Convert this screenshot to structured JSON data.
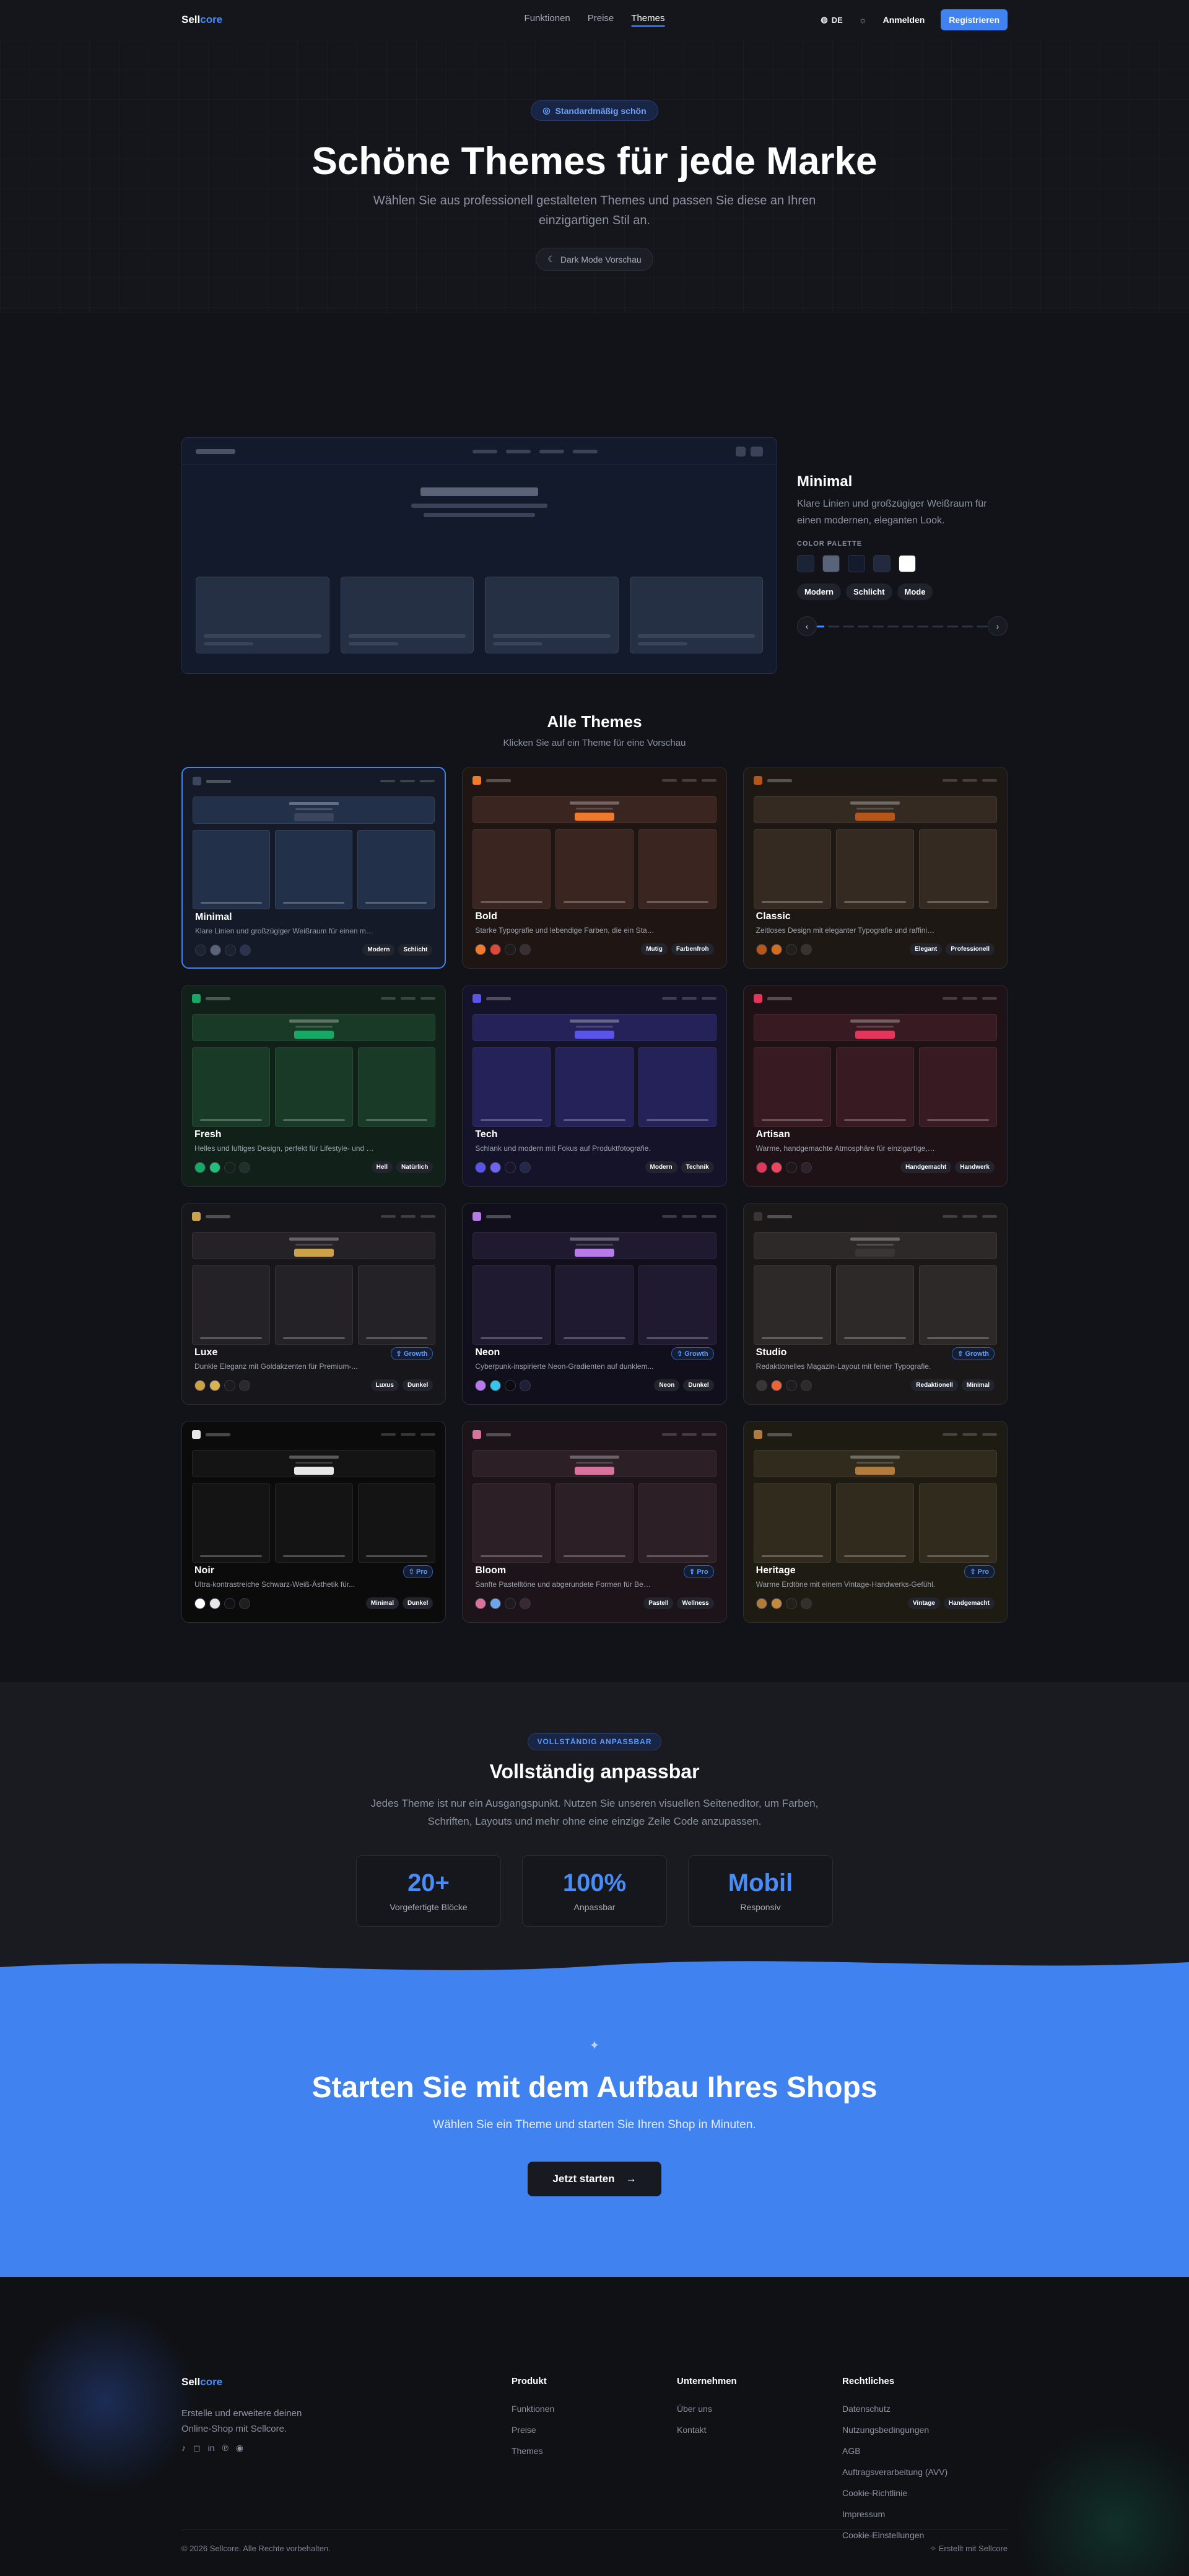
{
  "nav": {
    "logo_a": "Sell",
    "logo_b": "core",
    "links": [
      "Funktionen",
      "Preise",
      "Themes"
    ],
    "lang": "DE",
    "login": "Anmelden",
    "register": "Registrieren"
  },
  "hero": {
    "pill": "Standardmäßig schön",
    "title": "Schöne Themes für jede Marke",
    "subtitle": "Wählen Sie aus professionell gestalteten Themes und passen Sie diese an Ihren einzigartigen Stil an.",
    "dark_btn": "Dark Mode Vorschau"
  },
  "preview": {
    "name": "Minimal",
    "desc": "Klare Linien und großzügiger Weißraum für einen modernen, eleganten Look.",
    "palette_label": "COLOR PALETTE",
    "swatches": [
      "#1b2336",
      "#5a6478",
      "#141b2e",
      "#232a40",
      "#ffffff"
    ],
    "tags": [
      "Modern",
      "Schlicht",
      "Mode"
    ]
  },
  "all": {
    "title": "Alle Themes",
    "subtitle": "Klicken Sie auf ein Theme für eine Vorschau"
  },
  "themes": [
    {
      "name": "Minimal",
      "desc": "Klare Linien und großzügiger Weißraum für einen modernen,...",
      "tags": [
        "Modern",
        "Schlicht"
      ],
      "badge": "",
      "bg": "#141a28",
      "panel": "#223049",
      "accent": "#3b465e",
      "colors": [
        "#1e2231",
        "#5a6478",
        "#1b2130",
        "#2a3350"
      ]
    },
    {
      "name": "Bold",
      "desc": "Starke Typografie und lebendige Farben, die ein Statement setzen.",
      "tags": [
        "Mutig",
        "Farbenfroh"
      ],
      "badge": "",
      "bg": "#1f1513",
      "panel": "#3a2520",
      "accent": "#f07a2c",
      "colors": [
        "#f07a2c",
        "#e0483a",
        "#1f1b1b",
        "#3a3030"
      ]
    },
    {
      "name": "Classic",
      "desc": "Zeitloses Design mit eleganter Typografie und raffinierten Details.",
      "tags": [
        "Elegant",
        "Professionell"
      ],
      "badge": "",
      "bg": "#1e1814",
      "panel": "#352a22",
      "accent": "#b5561a",
      "colors": [
        "#b5561a",
        "#d26c22",
        "#241f1c",
        "#3a332d"
      ]
    },
    {
      "name": "Fresh",
      "desc": "Helles und luftiges Design, perfekt für Lifestyle- und Wellness-...",
      "tags": [
        "Hell",
        "Natürlich"
      ],
      "badge": "",
      "bg": "#112018",
      "panel": "#1a3a28",
      "accent": "#17a865",
      "colors": [
        "#17a865",
        "#21c07a",
        "#15201b",
        "#22302a"
      ]
    },
    {
      "name": "Tech",
      "desc": "Schlank und modern mit Fokus auf Produktfotografie.",
      "tags": [
        "Modern",
        "Technik"
      ],
      "badge": "",
      "bg": "#15132a",
      "panel": "#252259",
      "accent": "#5a55e8",
      "colors": [
        "#5a55e8",
        "#6f63f0",
        "#15162a",
        "#25284a"
      ]
    },
    {
      "name": "Artisan",
      "desc": "Warme, handgemachte Atmosphäre für einzigartige, handwerklic...",
      "tags": [
        "Handgemacht",
        "Handwerk"
      ],
      "badge": "",
      "bg": "#1f1216",
      "panel": "#381a22",
      "accent": "#e2365a",
      "colors": [
        "#e2365a",
        "#f0455e",
        "#1f1618",
        "#30222a"
      ]
    },
    {
      "name": "Luxe",
      "desc": "Dunkle Eleganz mit Goldakzenten für Premium-...",
      "tags": [
        "Luxus",
        "Dunkel"
      ],
      "badge": "Growth",
      "bg": "#17161a",
      "panel": "#242226",
      "accent": "#c9a24a",
      "colors": [
        "#c9a24a",
        "#d8b255",
        "#1b1a1d",
        "#2a292c"
      ]
    },
    {
      "name": "Neon",
      "desc": "Cyberpunk-inspirierte Neon-Gradienten auf dunklem...",
      "tags": [
        "Neon",
        "Dunkel"
      ],
      "badge": "Growth",
      "bg": "#120f1c",
      "panel": "#1f1a30",
      "accent": "#b67be8",
      "colors": [
        "#b67be8",
        "#36c6e8",
        "#0c0b12",
        "#1f1f3a"
      ]
    },
    {
      "name": "Studio",
      "desc": "Redaktionelles Magazin-Layout mit feiner Typografie.",
      "tags": [
        "Redaktionell",
        "Minimal"
      ],
      "badge": "Growth",
      "bg": "#1a1818",
      "panel": "#2c2928",
      "accent": "#3a3634",
      "colors": [
        "#3a3634",
        "#e8653a",
        "#1e1c1c",
        "#2e2b2b"
      ]
    },
    {
      "name": "Noir",
      "desc": "Ultra-kontrastreiche Schwarz-Weiß-Ästhetik für...",
      "tags": [
        "Minimal",
        "Dunkel"
      ],
      "badge": "Pro",
      "bg": "#0b0b0c",
      "panel": "#141415",
      "accent": "#e8e8e8",
      "colors": [
        "#ffffff",
        "#e8e8e8",
        "#111111",
        "#1f1f1f"
      ]
    },
    {
      "name": "Bloom",
      "desc": "Sanfte Pastelltöne und abgerundete Formen für Beauty-...",
      "tags": [
        "Pastell",
        "Wellness"
      ],
      "badge": "Pro",
      "bg": "#1c1419",
      "panel": "#2c1f26",
      "accent": "#d8739e",
      "colors": [
        "#d8739e",
        "#6ea5e8",
        "#1f1a1d",
        "#3a2a30"
      ]
    },
    {
      "name": "Heritage",
      "desc": "Warme Erdtöne mit einem Vintage-Handwerks-Gefühl.",
      "tags": [
        "Vintage",
        "Handgemacht"
      ],
      "badge": "Pro",
      "bg": "#1e1b12",
      "panel": "#302b1d",
      "accent": "#b07b3c",
      "colors": [
        "#b07b3c",
        "#c48a42",
        "#222018",
        "#33302a"
      ]
    }
  ],
  "custom": {
    "pill": "VOLLSTÄNDIG ANPASSBAR",
    "title": "Vollständig anpassbar",
    "text": "Jedes Theme ist nur ein Ausgangspunkt. Nutzen Sie unseren visuellen Seiteneditor, um Farben, Schriften, Layouts und mehr ohne eine einzige Zeile Code anzupassen.",
    "stats": [
      {
        "value": "20+",
        "label": "Vorgefertigte Blöcke"
      },
      {
        "value": "100%",
        "label": "Anpassbar"
      },
      {
        "value": "Mobil",
        "label": "Responsiv"
      }
    ]
  },
  "cta": {
    "title": "Starten Sie mit dem Aufbau Ihres Shops",
    "subtitle": "Wählen Sie ein Theme und starten Sie Ihren Shop in Minuten.",
    "button": "Jetzt starten"
  },
  "footer": {
    "tagline": "Erstelle und erweitere deinen Online-Shop mit Sellcore.",
    "cols": [
      {
        "title": "Produkt",
        "items": [
          "Funktionen",
          "Preise",
          "Themes"
        ]
      },
      {
        "title": "Unternehmen",
        "items": [
          "Über uns",
          "Kontakt"
        ]
      },
      {
        "title": "Rechtliches",
        "items": [
          "Datenschutz",
          "Nutzungsbedingungen",
          "AGB",
          "Auftragsverarbeitung (AVV)",
          "Cookie-Richtlinie",
          "Impressum",
          "Cookie-Einstellungen"
        ]
      }
    ],
    "copyright": "© 2026 Sellcore. Alle Rechte vorbehalten.",
    "made": "Erstellt mit Sellcore"
  }
}
